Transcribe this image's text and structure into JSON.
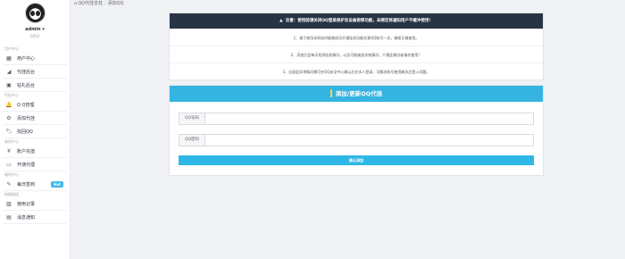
{
  "breadcrumb": {
    "icon": "home-icon",
    "parent": "QQ代挂支柱",
    "current": "添加QQ"
  },
  "user": {
    "name": "admin",
    "caret": "▾",
    "sub": "LV0/2"
  },
  "sidebar": {
    "sections": [
      {
        "title": "用户中心",
        "items": [
          {
            "label": "用户中心",
            "icon": "grid-icon",
            "glyph": "▦"
          },
          {
            "label": "代挂后台",
            "icon": "chart-icon",
            "glyph": "◢"
          },
          {
            "label": "钻礼后台",
            "icon": "gift-icon",
            "glyph": "▣"
          }
        ]
      },
      {
        "title": "代挂中心",
        "items": [
          {
            "label": "Q Q管理",
            "icon": "bell-icon",
            "glyph": "🔔"
          },
          {
            "label": "添加代挂",
            "icon": "gear-icon",
            "glyph": "⚙"
          },
          {
            "label": "找回QQ",
            "icon": "tag-icon",
            "glyph": "🏷"
          }
        ]
      },
      {
        "title": "商用中心",
        "items": [
          {
            "label": "账户充值",
            "icon": "yen-icon",
            "glyph": "¥"
          },
          {
            "label": "开通代理",
            "icon": "id-card-icon",
            "glyph": "▭"
          }
        ]
      },
      {
        "title": "福利中心",
        "items": [
          {
            "label": "每日签到",
            "icon": "pencil-icon",
            "glyph": "✎",
            "badge": "Hot"
          }
        ]
      },
      {
        "title": "快捷链接",
        "items": [
          {
            "label": "使用记录",
            "icon": "image-icon",
            "glyph": "▨"
          },
          {
            "label": "消息通知",
            "icon": "log-icon",
            "glyph": "▤"
          }
        ]
      }
    ]
  },
  "notice": {
    "head": "注意：使用前请关闭QQ登录保护及设备锁等功能，未绑定将通知用户不缓冲使用！",
    "head_icon": "warning-icon",
    "rows": [
      "1、请于使用本网站时能够成功开通挂机功能任意QQ账号一次，确保正确使用。",
      "2、添加后会每天检测挂机情况，以及可能被迫冻结情况，介意此情况者请勿使用！",
      "3、出现此异常情况需可在QQ安全中心确认后在本人登录，可解冻账号使用解冻后登入问题。"
    ]
  },
  "form": {
    "title": "添加/更新QQ代挂",
    "qq_label": "QQ号码",
    "qq_value": "",
    "qq_placeholder": "",
    "pwd_label": "QQ密码",
    "pwd_value": "",
    "pwd_placeholder": "",
    "submit": "确认添加"
  },
  "colors": {
    "accent": "#35b3e1",
    "notice_bg": "#273444",
    "badge": "#3eb7e8"
  }
}
